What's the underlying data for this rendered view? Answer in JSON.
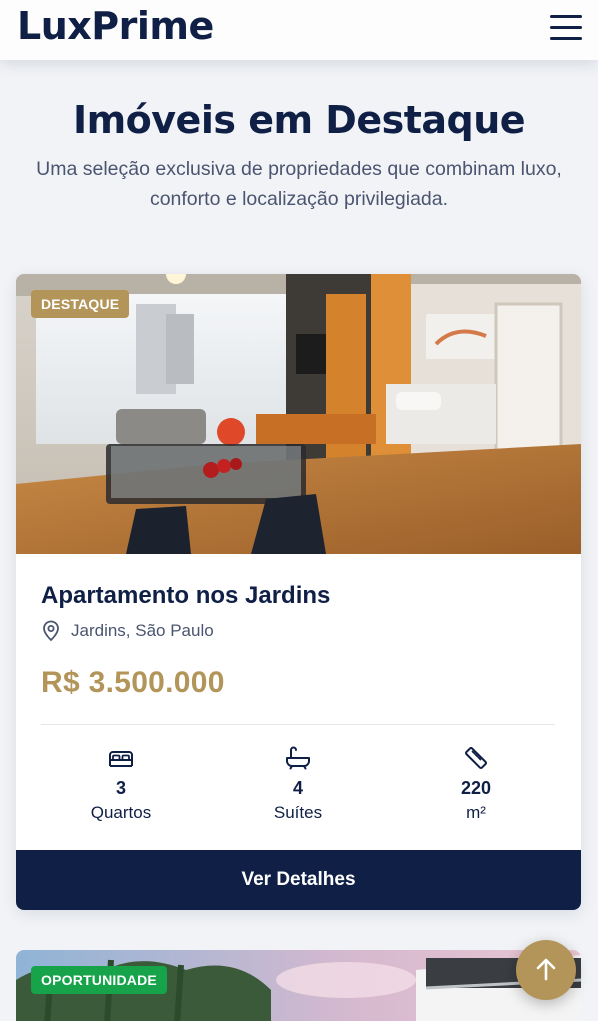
{
  "header": {
    "logo": "LuxPrime",
    "menu_icon": "hamburger-menu-icon"
  },
  "hero": {
    "title": "Imóveis em Destaque",
    "subtitle": "Uma seleção exclusiva de propriedades que combinam luxo, conforto e localização privilegiada."
  },
  "listings": [
    {
      "badge": "DESTAQUE",
      "badge_color": "#b3955a",
      "title": "Apartamento nos Jardins",
      "location": "Jardins, São Paulo",
      "price": "R$ 3.500.000",
      "features": [
        {
          "icon": "bed-icon",
          "value": "3",
          "label": "Quartos"
        },
        {
          "icon": "bathtub-icon",
          "value": "4",
          "label": "Suítes"
        },
        {
          "icon": "ruler-icon",
          "value": "220",
          "label": "m²"
        }
      ],
      "button": "Ver Detalhes"
    },
    {
      "badge": "OPORTUNIDADE",
      "badge_color": "#16a34a"
    }
  ],
  "fab": {
    "icon": "arrow-up-icon"
  },
  "colors": {
    "navy": "#0f1f45",
    "gold": "#b3955a",
    "green": "#16a34a"
  }
}
